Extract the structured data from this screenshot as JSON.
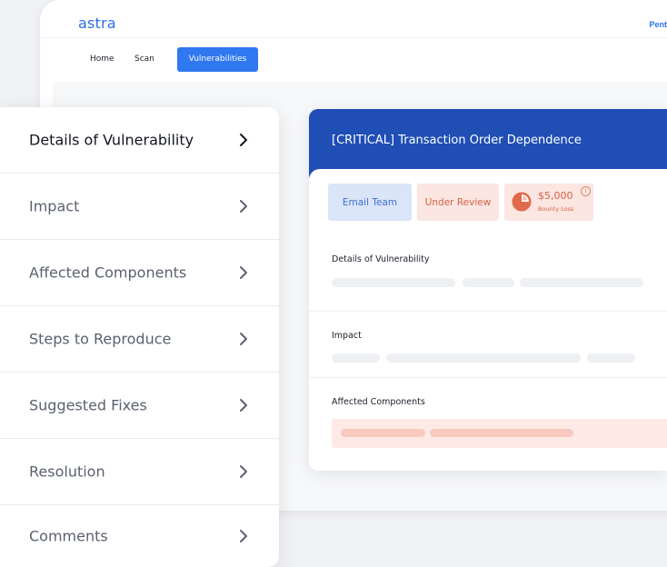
{
  "app": {
    "logo": "astra",
    "top_right_link": "Pent"
  },
  "nav": {
    "items": [
      {
        "label": "Home",
        "active": false
      },
      {
        "label": "Scan",
        "active": false
      },
      {
        "label": "Vulnerabilities",
        "active": true
      }
    ]
  },
  "vulnerability": {
    "title": "[CRITICAL] Transaction Order Dependence",
    "email_button": "Email Team",
    "status": "Under Review",
    "bounty_amount": "$5,000",
    "bounty_label": "Bounty Loss",
    "sections": [
      {
        "title": "Details of Vulnerability"
      },
      {
        "title": "Impact"
      },
      {
        "title": "Affected Components"
      }
    ]
  },
  "sidebar": {
    "items": [
      {
        "label": "Details of Vulnerability",
        "active": true
      },
      {
        "label": "Impact",
        "active": false
      },
      {
        "label": "Affected Components",
        "active": false
      },
      {
        "label": "Steps to Reproduce",
        "active": false
      },
      {
        "label": "Suggested Fixes",
        "active": false
      },
      {
        "label": "Resolution",
        "active": false
      },
      {
        "label": "Comments",
        "active": false
      }
    ]
  },
  "colors": {
    "brand_blue": "#2f78f0",
    "header_blue": "#1f4eb5",
    "critical_red": "#d66245",
    "chip_blue_bg": "#dbe5f8",
    "chip_red_bg": "#fbe6e1"
  },
  "icons": {
    "chevron": "chevron-right-icon",
    "bounty": "pie-chart-icon",
    "info": "info-icon"
  }
}
